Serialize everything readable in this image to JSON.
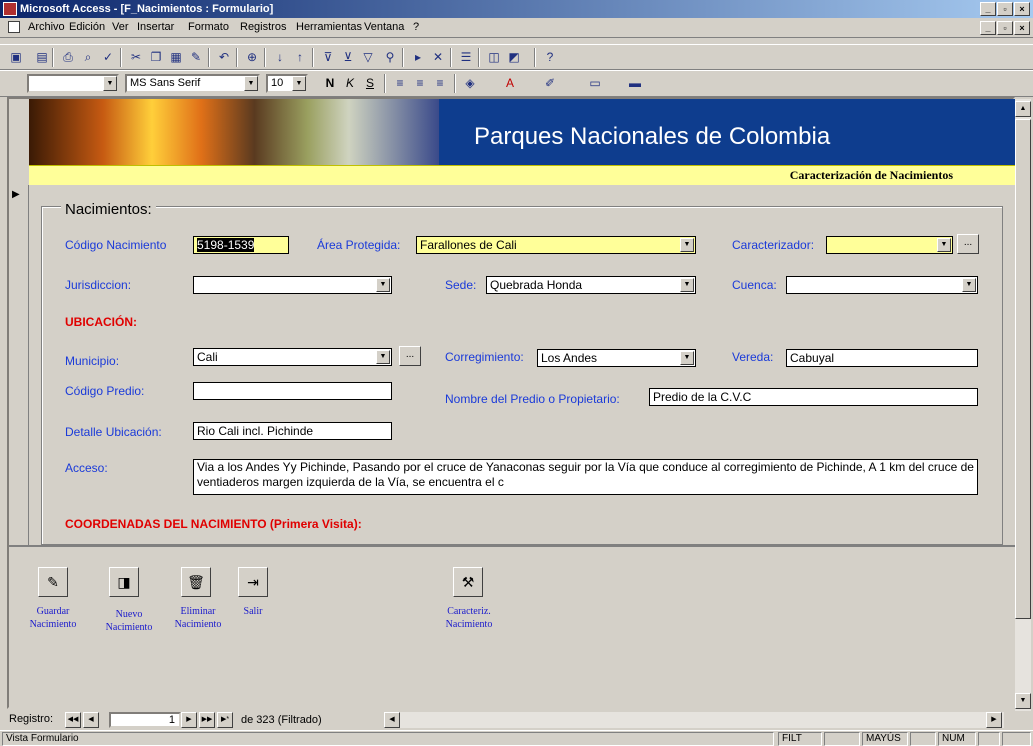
{
  "window": {
    "title": "Microsoft Access - [F_Nacimientos : Formulario]"
  },
  "menu": [
    "Archivo",
    "Edición",
    "Ver",
    "Insertar",
    "Formato",
    "Registros",
    "Herramientas",
    "Ventana",
    "?"
  ],
  "format_toolbar": {
    "object_combo": "",
    "font": "MS Sans Serif",
    "size": "10"
  },
  "banner": {
    "title": "Parques Nacionales de Colombia",
    "subtitle": "Caracterización de Nacimientos"
  },
  "form": {
    "group_title": "Nacimientos:",
    "codigo_label": "Código Nacimiento",
    "codigo_value": "5198-1539",
    "area_label": "Área Protegida:",
    "area_value": "Farallones de Cali",
    "caracterizador_label": "Caracterizador:",
    "caracterizador_value": "",
    "jurisdiccion_label": "Jurisdiccion:",
    "jurisdiccion_value": "",
    "sede_label": "Sede:",
    "sede_value": "Quebrada Honda",
    "cuenca_label": "Cuenca:",
    "cuenca_value": "",
    "ubicacion_heading": "UBICACIÓN:",
    "municipio_label": "Municipio:",
    "municipio_value": "Cali",
    "corregimiento_label": "Corregimiento:",
    "corregimiento_value": "Los Andes",
    "vereda_label": "Vereda:",
    "vereda_value": "Cabuyal",
    "predio_label": "Código Predio:",
    "predio_value": "",
    "propietario_label": "Nombre del Predio o Propietario:",
    "propietario_value": "Predio de la C.V.C",
    "detalle_label": "Detalle Ubicación:",
    "detalle_value": "Rio Cali incl. Pichinde",
    "acceso_label": "Acceso:",
    "acceso_value": "Via a los Andes Yy Pichinde, Pasando por el cruce de Yanaconas seguir por la Vía que conduce al corregimiento de Pichinde, A 1 km del cruce de ventiaderos margen izquierda de la Vía, se encuentra el c",
    "coordenadas_heading": "COORDENADAS DEL NACIMIENTO (Primera Visita):",
    "dots_label": "..."
  },
  "footer_buttons": {
    "guardar": "Guardar Nacimiento",
    "nuevo": "Nuevo Nacimiento",
    "eliminar": "Eliminar Nacimiento",
    "salir": "Salir",
    "caracteriz": "Caracteriz. Nacimiento"
  },
  "navigation": {
    "label": "Registro:",
    "current": "1",
    "total": "de  323 (Filtrado)"
  },
  "status": {
    "view": "Vista Formulario",
    "filt": "FILT",
    "mayus": "MAYÚS",
    "num": "NUM"
  }
}
